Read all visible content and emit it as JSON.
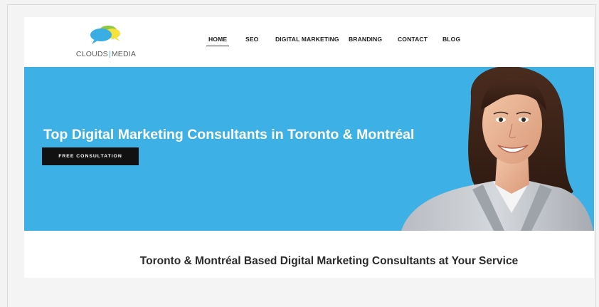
{
  "brand": {
    "logo_word_1": "CLOUDS",
    "logo_separator": "|",
    "logo_word_2": "MEDIA",
    "colors": {
      "blue": "#3aaee4",
      "green": "#8dc63f",
      "yellow": "#f5e23a"
    }
  },
  "nav": {
    "items": [
      {
        "label": "HOME",
        "active": true
      },
      {
        "label": "SEO"
      },
      {
        "label": "DIGITAL MARKETING"
      },
      {
        "label": "BRANDING"
      },
      {
        "label": "CONTACT"
      },
      {
        "label": "BLOG"
      }
    ]
  },
  "hero": {
    "title": "Top Digital Marketing Consultants in Toronto & Montréal",
    "cta_label": "FREE CONSULTATION",
    "background_color": "#3db1e6",
    "image": "smiling-woman-photo"
  },
  "tagline": "Toronto & Montréal Based Digital Marketing Consultants at Your Service"
}
